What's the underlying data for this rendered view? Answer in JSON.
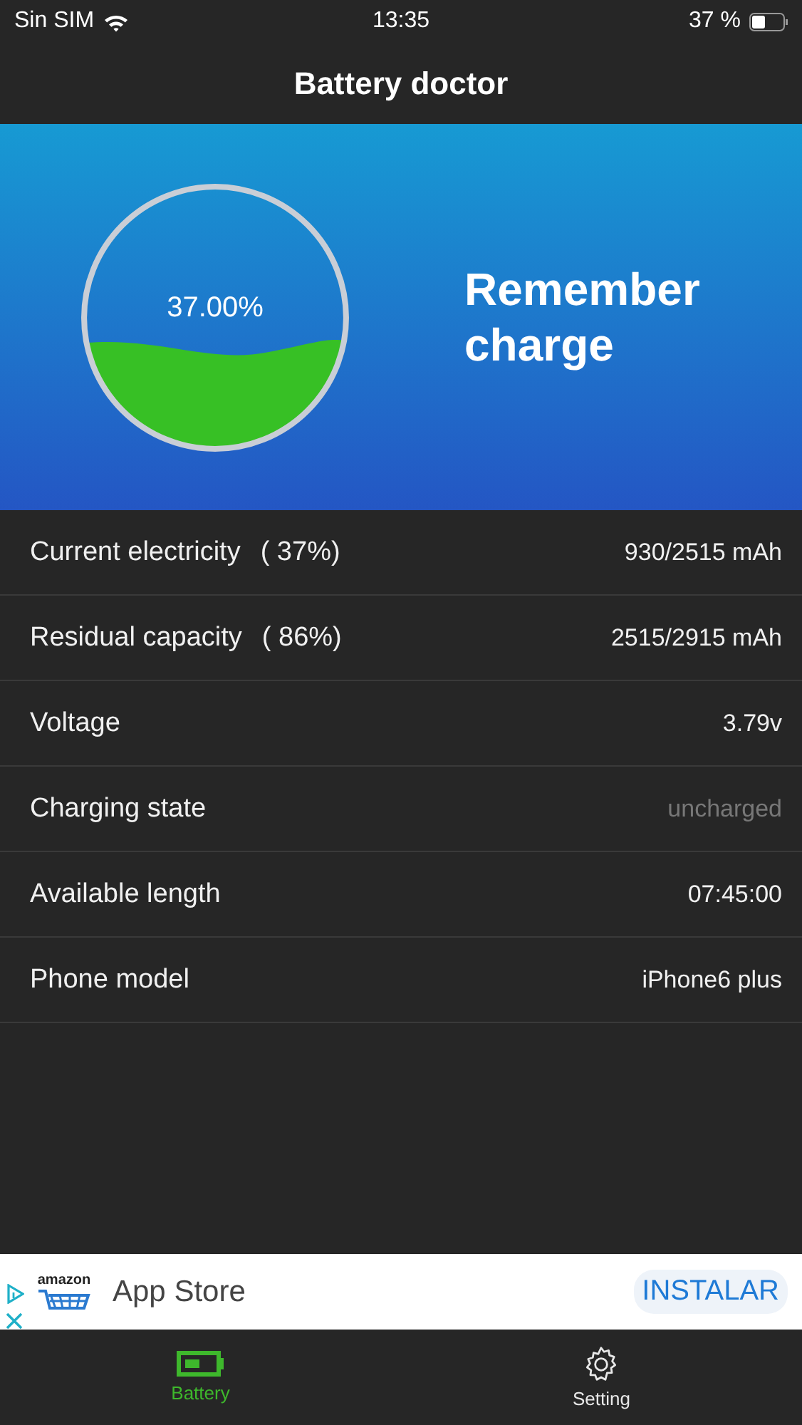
{
  "status_bar": {
    "carrier": "Sin SIM",
    "time": "13:35",
    "battery": "37 %"
  },
  "nav": {
    "title": "Battery doctor"
  },
  "hero": {
    "gauge": {
      "reading": "37.00%"
    },
    "message": "Remember charge"
  },
  "rows": [
    {
      "label": "Current electricity",
      "extra": "( 37%)",
      "value": "930/2515 mAh",
      "dimmed": false
    },
    {
      "label": "Residual capacity",
      "extra": "( 86%)",
      "value": "2515/2915 mAh",
      "dimmed": false
    },
    {
      "label": "Voltage",
      "value": "3.79v",
      "dimmed": false
    },
    {
      "label": "Charging state",
      "value": "uncharged",
      "dimmed": true
    },
    {
      "label": "Available length",
      "value": "07:45:00",
      "dimmed": false
    },
    {
      "label": "Phone model",
      "value": "iPhone6 plus",
      "dimmed": false
    }
  ],
  "ad": {
    "logo_text": "amazon",
    "title": "App Store",
    "button": "INSTALAR"
  },
  "tabs": [
    {
      "kind": "battery",
      "label": "Battery",
      "selected": true
    },
    {
      "kind": "gear",
      "label": "Setting",
      "selected": false
    }
  ]
}
